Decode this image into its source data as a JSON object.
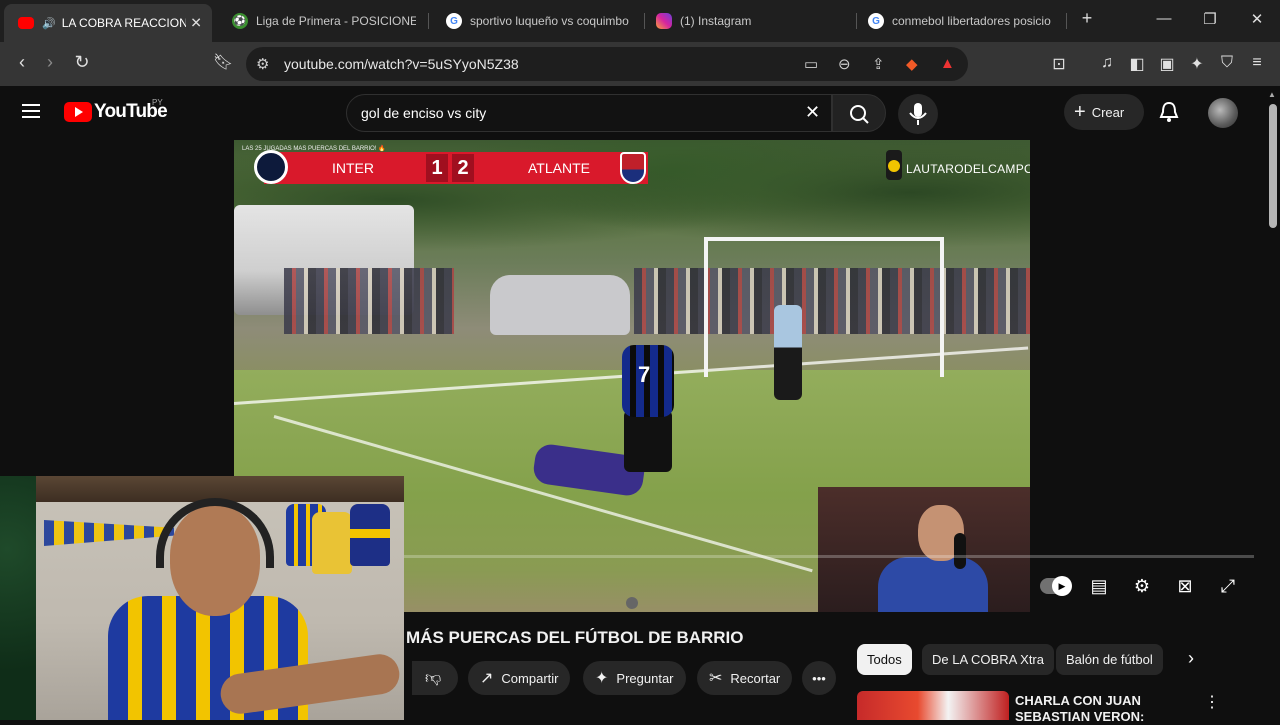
{
  "browser": {
    "tabs": [
      {
        "title": "LA COBRA REACCIONA",
        "active": true,
        "icon": "youtube-icon"
      },
      {
        "title": "Liga de Primera - POSICIONES",
        "active": false,
        "icon": "soccer-ball-icon"
      },
      {
        "title": "sportivo luqueño vs coquimbo",
        "active": false,
        "icon": "google-icon"
      },
      {
        "title": "(1) Instagram",
        "active": false,
        "icon": "instagram-icon"
      },
      {
        "title": "conmebol libertadores posicio",
        "active": false,
        "icon": "google-icon"
      }
    ],
    "new_tab_label": "+",
    "url": "youtube.com/watch?v=5uSYyoN5Z38"
  },
  "youtube": {
    "logo_text": "YouTube",
    "country_code": "PY",
    "search_value": "gol de enciso vs city",
    "create_label": "Crear"
  },
  "video": {
    "scoreboard": {
      "caption": "LAS 25 JUGADAS MAS PUERCAS DEL BARRIO! 🔥",
      "home_team": "INTER",
      "home_score": "1",
      "away_score": "2",
      "away_team": "ATLANTE"
    },
    "watermark": "LAUTARODELCAMPO",
    "player_number": "7",
    "title": "MÁS PUERCAS DEL FÚTBOL DE BARRIO",
    "actions": {
      "share": "Compartir",
      "ask": "Preguntar",
      "clip": "Recortar"
    }
  },
  "recommendations": {
    "chips": [
      "Todos",
      "De LA COBRA Xtra",
      "Balón de fútbol"
    ],
    "selected_chip": "Todos",
    "items": [
      {
        "title": "CHARLA CON JUAN SEBASTIAN VERON:"
      }
    ]
  },
  "colors": {
    "youtube_red": "#ff0000",
    "scoreboard_red": "#d9192b",
    "background": "#0f0f0f"
  }
}
